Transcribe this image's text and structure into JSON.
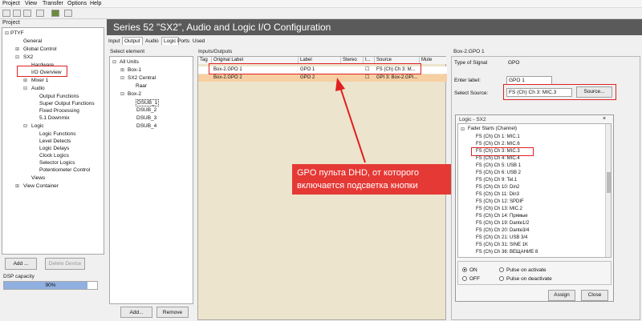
{
  "menu": [
    "Project",
    "View",
    "Transfer",
    "Options",
    "Help"
  ],
  "project_panel": {
    "title": "Project",
    "tree": [
      "PTYF",
      "General",
      "Global Control",
      "SX2",
      "Hardware",
      "I/O Overview",
      "Mixer 1",
      "Audio",
      "Output Functions",
      "Super Output Functions",
      "Fixed Processing",
      "5.1 Downmix",
      "Logic",
      "Logic Functions",
      "Level Detects",
      "Logic Delays",
      "Clock Logics",
      "Selector Logics",
      "Potentiometer Control",
      "Views",
      "View Container"
    ],
    "add_button": "Add ...",
    "delete_button": "Delete Device",
    "dsp_label": "DSP capacity",
    "dsp_value": "90%",
    "dsp_fraction": 0.9
  },
  "header_title": "Series 52 \"SX2\", Audio and Logic I/O  Configuration",
  "tabs": [
    "Input",
    "Output",
    "Audio",
    "Logic",
    "Ports",
    "Used"
  ],
  "select_panel": {
    "title": "Select element",
    "tree": [
      "All Units",
      "Box-1",
      "SX2 Central",
      "Raar",
      "Box-2",
      "DSUB_1",
      "DSUB_2",
      "DSUB_3",
      "DSUB_4"
    ],
    "add_button": "Add...",
    "remove_button": "Remove"
  },
  "io_panel": {
    "title": "Inputs/Outputs",
    "columns": [
      "Tag",
      "Original Label",
      "Label",
      "Stereo",
      "I...",
      "Source",
      "Mute"
    ],
    "rows": [
      {
        "label": "Box-2.GPO 1",
        "name": "GPO 1",
        "source": "FS (Ch) Ch 3: M..."
      },
      {
        "label": "Box-2.GPO 2",
        "name": "GPO 2",
        "source": "GPI 3: Box-2.GPI..."
      }
    ]
  },
  "annotation": "GPO пульта DHD, от которого включается подсветка кнопки",
  "details": {
    "title": "Box-2.GPO 1",
    "type_label": "Type of Signal",
    "type_value": "GPO",
    "enter_label": "Enter label:",
    "label_value": "GPO 1",
    "source_label": "Select Source:",
    "source_value": "FS (Ch) Ch 3: MIC.3",
    "source_button": "Source..."
  },
  "logic_dialog": {
    "title": "Logic - SX2",
    "group": "Fader Starts (Channel)",
    "items": [
      "FS (Ch) Ch 1: MIC.1",
      "FS (Ch) Ch 2: MIC.6",
      "FS (Ch) Ch 3: MIC.3",
      "FS (Ch) Ch 4: MIC.4",
      "FS (Ch) Ch 5: USB 1",
      "FS (Ch) Ch 6: USB 2",
      "FS (Ch) Ch 9: Tel.1",
      "FS (Ch) Ch 10: Din2",
      "FS (Ch) Ch 11: Din3",
      "FS (Ch) Ch 12: SPDIF",
      "FS (Ch) Ch 13: MIC.2",
      "FS (Ch) Ch 14: Прямые",
      "FS (Ch) Ch 19: Dante1/2",
      "FS (Ch) Ch 20: Dante3/4",
      "FS (Ch) Ch 21: USB 3/4",
      "FS (Ch) Ch 31: SINE 1K",
      "FS (Ch) Ch 36: ВЕЩАНИЕ 8"
    ],
    "radio_on": "ON",
    "radio_off": "OFF",
    "pulse_activate": "Pulse on activate",
    "pulse_deactivate": "Pulse on deactivate",
    "assign_button": "Assign",
    "close_button": "Close"
  },
  "colors": {
    "highlight_red": "#e02020",
    "annotation_bg": "#e53935",
    "header_bg": "#5a5a5a",
    "grid_bg": "#ede4cd"
  }
}
